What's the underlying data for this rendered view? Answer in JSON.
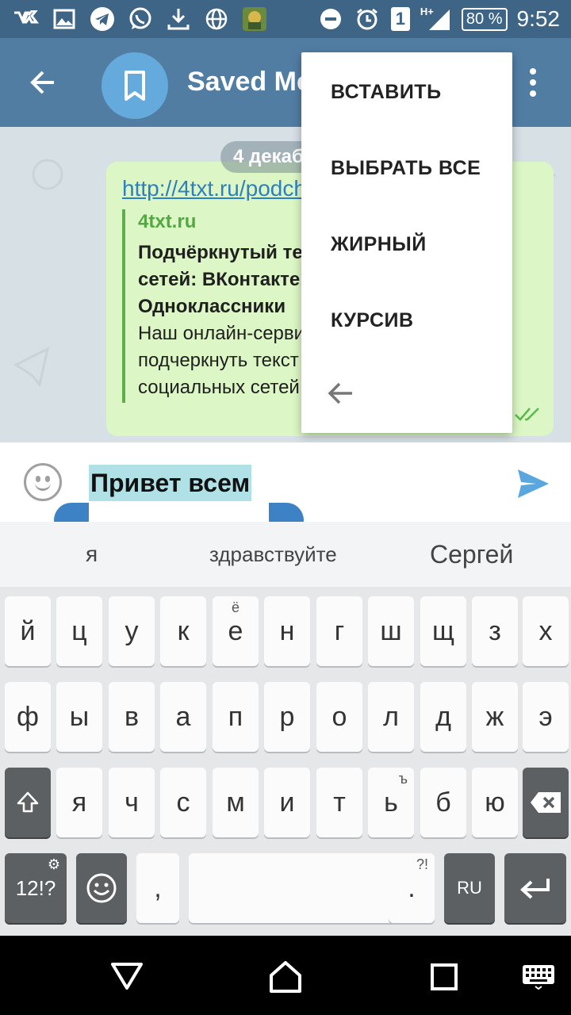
{
  "status_bar": {
    "left_icons": [
      "vk-icon",
      "image-icon",
      "telegram-icon",
      "whatsapp-icon",
      "download-icon",
      "globe-icon",
      "game-icon"
    ],
    "network": "H+",
    "sim": "1",
    "battery": "80 %",
    "time": "9:52"
  },
  "header": {
    "title": "Saved Messages"
  },
  "chat": {
    "date": "4 декабря",
    "message": {
      "link": "http://4txt.ru/podcherknutyj-tekst",
      "preview_site": "4txt.ru",
      "preview_title": "Подчёркнутый текст для социальных сетей: ВКонтакте, Фейсбук, Инстаграм, Одноклассники",
      "preview_description": "Наш онлайн-сервис позволяет легко подчеркнуть текст для популярных социальных сетей"
    }
  },
  "context_menu": {
    "items": [
      "ВСТАВИТЬ",
      "ВЫБРАТЬ ВСЕ",
      "ЖИРНЫЙ",
      "КУРСИВ"
    ]
  },
  "input": {
    "value": "Привет всем"
  },
  "suggestions": [
    "я",
    "здравствуйте",
    "Сергей"
  ],
  "keyboard": {
    "row1": [
      "й",
      "ц",
      "у",
      "к",
      "е",
      "н",
      "г",
      "ш",
      "щ",
      "з",
      "х"
    ],
    "row1_hints": {
      "4": "ё"
    },
    "row2": [
      "ф",
      "ы",
      "в",
      "а",
      "п",
      "р",
      "о",
      "л",
      "д",
      "ж",
      "э"
    ],
    "row3": [
      "я",
      "ч",
      "с",
      "м",
      "и",
      "т",
      "ь",
      "б",
      "ю"
    ],
    "row3_hints": {
      "6": "ъ"
    },
    "symbols_label": "12!?",
    "comma": ",",
    "period": ".",
    "period_hint": "?!",
    "language_label": "RU"
  },
  "colors": {
    "header": "#527da3",
    "status_bar": "#3e6486",
    "bubble": "#dcf7c5",
    "accent": "#3d82c5",
    "selection": "#b0e1e7"
  }
}
